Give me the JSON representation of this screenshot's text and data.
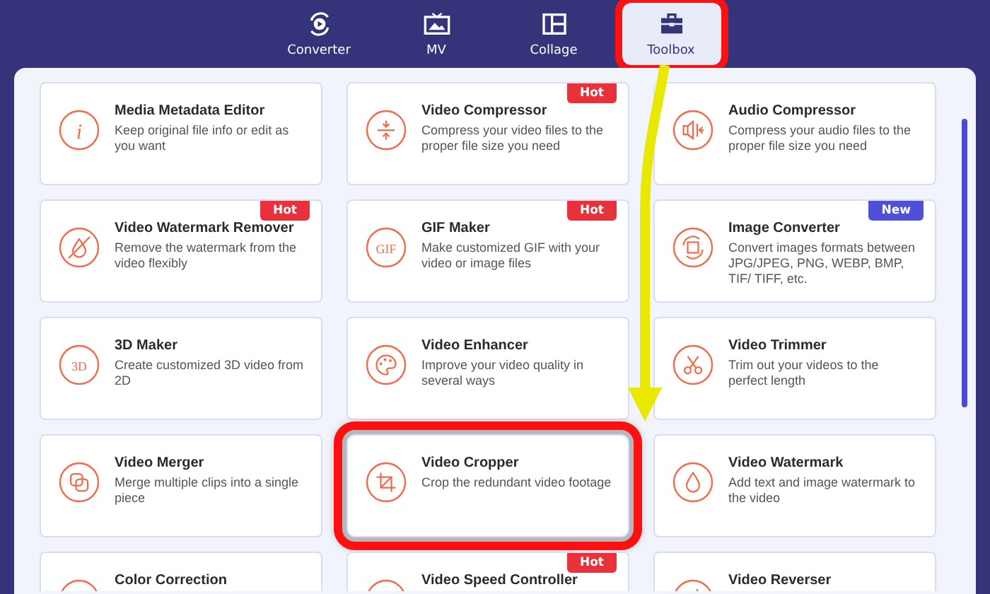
{
  "tabs": [
    {
      "label": "Converter",
      "selected": false,
      "highlighted": false
    },
    {
      "label": "MV",
      "selected": false,
      "highlighted": false
    },
    {
      "label": "Collage",
      "selected": false,
      "highlighted": false
    },
    {
      "label": "Toolbox",
      "selected": true,
      "highlighted": true
    }
  ],
  "tools": [
    {
      "title": "Media Metadata Editor",
      "description": "Keep original file info or edit as you want",
      "icon_text": "i",
      "highlighted": false
    },
    {
      "title": "Video Compressor",
      "description": "Compress your video files to the proper file size you need",
      "badge": {
        "text": "Hot",
        "color": "#e8313a"
      },
      "highlighted": false
    },
    {
      "title": "Audio Compressor",
      "description": "Compress your audio files to the proper file size you need",
      "highlighted": false
    },
    {
      "title": "Video Watermark Remover",
      "description": "Remove the watermark from the video flexibly",
      "badge": {
        "text": "Hot",
        "color": "#e8313a"
      },
      "highlighted": false
    },
    {
      "title": "GIF Maker",
      "description": "Make customized GIF with your video or image files",
      "icon_text": "GIF",
      "badge": {
        "text": "Hot",
        "color": "#e8313a"
      },
      "highlighted": false
    },
    {
      "title": "Image Converter",
      "description": "Convert images formats between JPG/JPEG, PNG, WEBP, BMP, TIF/ TIFF, etc.",
      "badge": {
        "text": "New",
        "color": "#4f4fd8"
      },
      "highlighted": false
    },
    {
      "title": "3D Maker",
      "description": "Create customized 3D video from 2D",
      "icon_text": "3D",
      "highlighted": false
    },
    {
      "title": "Video Enhancer",
      "description": "Improve your video quality in several ways",
      "highlighted": false
    },
    {
      "title": "Video Trimmer",
      "description": "Trim out your videos to the perfect length",
      "highlighted": false
    },
    {
      "title": "Video Merger",
      "description": "Merge multiple clips into a single piece",
      "highlighted": false
    },
    {
      "title": "Video Cropper",
      "description": "Crop the redundant video footage",
      "highlighted": true
    },
    {
      "title": "Video Watermark",
      "description": "Add text and image watermark to the video",
      "highlighted": false
    },
    {
      "title": "Color Correction",
      "highlighted": false
    },
    {
      "title": "Video Speed Controller",
      "badge": {
        "text": "Hot",
        "color": "#e8313a"
      },
      "highlighted": false
    },
    {
      "title": "Video Reverser",
      "highlighted": false
    }
  ]
}
